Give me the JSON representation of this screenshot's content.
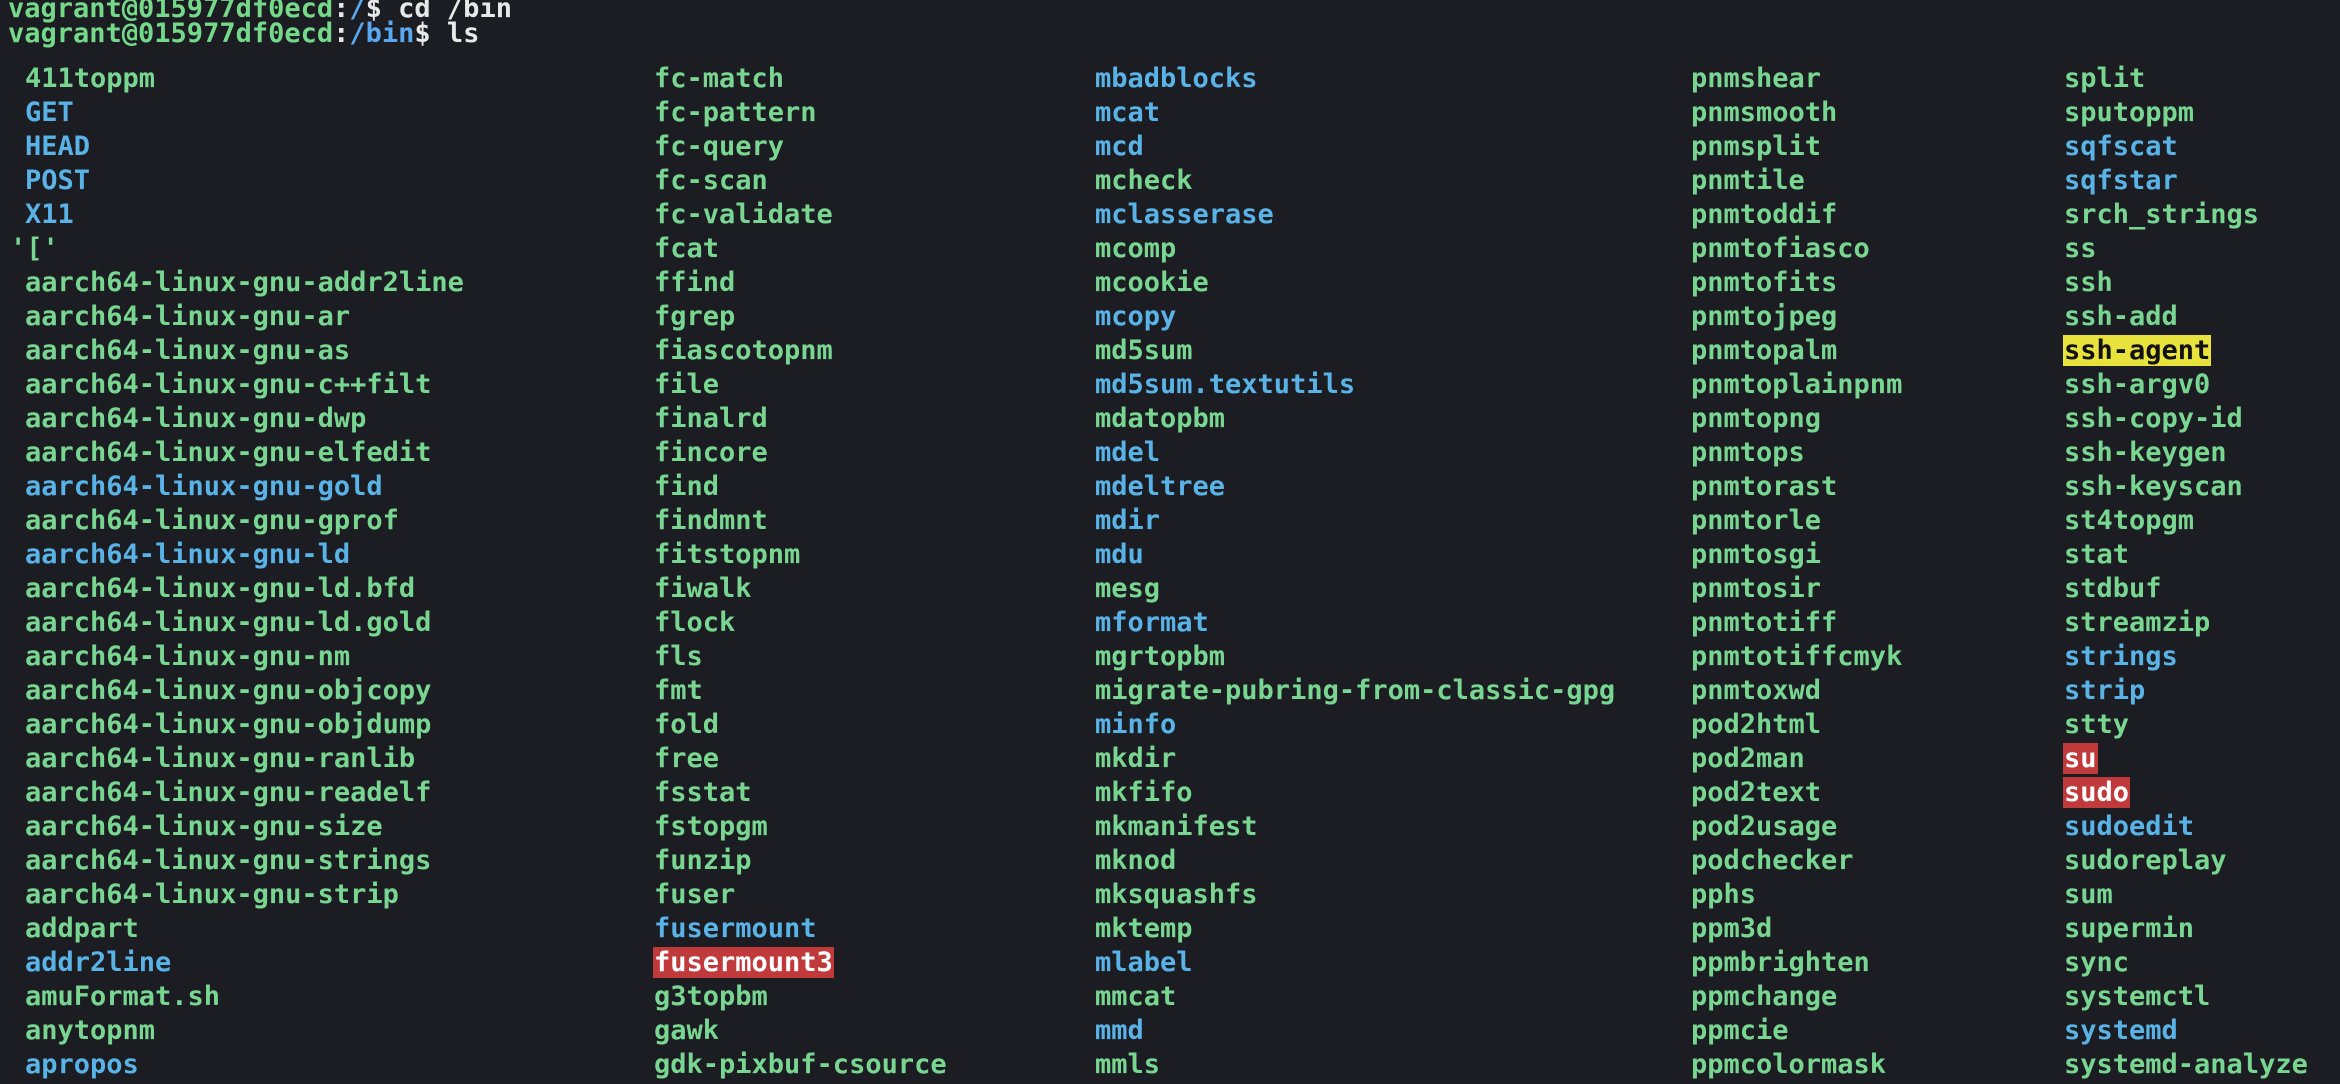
{
  "prompt1": {
    "user_host": "vagrant@015977df0ecd",
    "sep": ":",
    "path": "/",
    "dollar": "$",
    "command": " cd /bin"
  },
  "prompt2": {
    "user_host": "vagrant@015977df0ecd",
    "sep": ":",
    "path": "/bin",
    "dollar": "$",
    "command": " ls"
  },
  "colors": {
    "background": "#1b1d23",
    "executable": "#79d691",
    "symlink": "#5ab3e6",
    "setuid_bg": "#c0393b",
    "setgid_bg": "#e7e33c"
  },
  "listing": {
    "columns": [
      [
        {
          "name": "411toppm",
          "type": "exec"
        },
        {
          "name": "GET",
          "type": "link"
        },
        {
          "name": "HEAD",
          "type": "link"
        },
        {
          "name": "POST",
          "type": "link"
        },
        {
          "name": "X11",
          "type": "link"
        },
        {
          "name": "'['",
          "type": "exec"
        },
        {
          "name": "aarch64-linux-gnu-addr2line",
          "type": "exec"
        },
        {
          "name": "aarch64-linux-gnu-ar",
          "type": "exec"
        },
        {
          "name": "aarch64-linux-gnu-as",
          "type": "exec"
        },
        {
          "name": "aarch64-linux-gnu-c++filt",
          "type": "exec"
        },
        {
          "name": "aarch64-linux-gnu-dwp",
          "type": "exec"
        },
        {
          "name": "aarch64-linux-gnu-elfedit",
          "type": "exec"
        },
        {
          "name": "aarch64-linux-gnu-gold",
          "type": "link"
        },
        {
          "name": "aarch64-linux-gnu-gprof",
          "type": "exec"
        },
        {
          "name": "aarch64-linux-gnu-ld",
          "type": "link"
        },
        {
          "name": "aarch64-linux-gnu-ld.bfd",
          "type": "exec"
        },
        {
          "name": "aarch64-linux-gnu-ld.gold",
          "type": "exec"
        },
        {
          "name": "aarch64-linux-gnu-nm",
          "type": "exec"
        },
        {
          "name": "aarch64-linux-gnu-objcopy",
          "type": "exec"
        },
        {
          "name": "aarch64-linux-gnu-objdump",
          "type": "exec"
        },
        {
          "name": "aarch64-linux-gnu-ranlib",
          "type": "exec"
        },
        {
          "name": "aarch64-linux-gnu-readelf",
          "type": "exec"
        },
        {
          "name": "aarch64-linux-gnu-size",
          "type": "exec"
        },
        {
          "name": "aarch64-linux-gnu-strings",
          "type": "exec"
        },
        {
          "name": "aarch64-linux-gnu-strip",
          "type": "exec"
        },
        {
          "name": "addpart",
          "type": "exec"
        },
        {
          "name": "addr2line",
          "type": "link"
        },
        {
          "name": "amuFormat.sh",
          "type": "exec"
        },
        {
          "name": "anytopnm",
          "type": "exec"
        },
        {
          "name": "apropos",
          "type": "link"
        }
      ],
      [
        {
          "name": "fc-match",
          "type": "exec"
        },
        {
          "name": "fc-pattern",
          "type": "exec"
        },
        {
          "name": "fc-query",
          "type": "exec"
        },
        {
          "name": "fc-scan",
          "type": "exec"
        },
        {
          "name": "fc-validate",
          "type": "exec"
        },
        {
          "name": "fcat",
          "type": "exec"
        },
        {
          "name": "ffind",
          "type": "exec"
        },
        {
          "name": "fgrep",
          "type": "exec"
        },
        {
          "name": "fiascotopnm",
          "type": "exec"
        },
        {
          "name": "file",
          "type": "exec"
        },
        {
          "name": "finalrd",
          "type": "exec"
        },
        {
          "name": "fincore",
          "type": "exec"
        },
        {
          "name": "find",
          "type": "exec"
        },
        {
          "name": "findmnt",
          "type": "exec"
        },
        {
          "name": "fitstopnm",
          "type": "exec"
        },
        {
          "name": "fiwalk",
          "type": "exec"
        },
        {
          "name": "flock",
          "type": "exec"
        },
        {
          "name": "fls",
          "type": "exec"
        },
        {
          "name": "fmt",
          "type": "exec"
        },
        {
          "name": "fold",
          "type": "exec"
        },
        {
          "name": "free",
          "type": "exec"
        },
        {
          "name": "fsstat",
          "type": "exec"
        },
        {
          "name": "fstopgm",
          "type": "exec"
        },
        {
          "name": "funzip",
          "type": "exec"
        },
        {
          "name": "fuser",
          "type": "exec"
        },
        {
          "name": "fusermount",
          "type": "link"
        },
        {
          "name": "fusermount3",
          "type": "setuid"
        },
        {
          "name": "g3topbm",
          "type": "exec"
        },
        {
          "name": "gawk",
          "type": "exec"
        },
        {
          "name": "gdk-pixbuf-csource",
          "type": "exec"
        }
      ],
      [
        {
          "name": "mbadblocks",
          "type": "link"
        },
        {
          "name": "mcat",
          "type": "link"
        },
        {
          "name": "mcd",
          "type": "link"
        },
        {
          "name": "mcheck",
          "type": "exec"
        },
        {
          "name": "mclasserase",
          "type": "link"
        },
        {
          "name": "mcomp",
          "type": "exec"
        },
        {
          "name": "mcookie",
          "type": "exec"
        },
        {
          "name": "mcopy",
          "type": "link"
        },
        {
          "name": "md5sum",
          "type": "exec"
        },
        {
          "name": "md5sum.textutils",
          "type": "link"
        },
        {
          "name": "mdatopbm",
          "type": "exec"
        },
        {
          "name": "mdel",
          "type": "link"
        },
        {
          "name": "mdeltree",
          "type": "link"
        },
        {
          "name": "mdir",
          "type": "link"
        },
        {
          "name": "mdu",
          "type": "link"
        },
        {
          "name": "mesg",
          "type": "exec"
        },
        {
          "name": "mformat",
          "type": "link"
        },
        {
          "name": "mgrtopbm",
          "type": "exec"
        },
        {
          "name": "migrate-pubring-from-classic-gpg",
          "type": "exec"
        },
        {
          "name": "minfo",
          "type": "link"
        },
        {
          "name": "mkdir",
          "type": "exec"
        },
        {
          "name": "mkfifo",
          "type": "exec"
        },
        {
          "name": "mkmanifest",
          "type": "exec"
        },
        {
          "name": "mknod",
          "type": "exec"
        },
        {
          "name": "mksquashfs",
          "type": "exec"
        },
        {
          "name": "mktemp",
          "type": "exec"
        },
        {
          "name": "mlabel",
          "type": "link"
        },
        {
          "name": "mmcat",
          "type": "exec"
        },
        {
          "name": "mmd",
          "type": "link"
        },
        {
          "name": "mmls",
          "type": "exec"
        }
      ],
      [
        {
          "name": "pnmshear",
          "type": "exec"
        },
        {
          "name": "pnmsmooth",
          "type": "exec"
        },
        {
          "name": "pnmsplit",
          "type": "exec"
        },
        {
          "name": "pnmtile",
          "type": "exec"
        },
        {
          "name": "pnmtoddif",
          "type": "exec"
        },
        {
          "name": "pnmtofiasco",
          "type": "exec"
        },
        {
          "name": "pnmtofits",
          "type": "exec"
        },
        {
          "name": "pnmtojpeg",
          "type": "exec"
        },
        {
          "name": "pnmtopalm",
          "type": "exec"
        },
        {
          "name": "pnmtoplainpnm",
          "type": "exec"
        },
        {
          "name": "pnmtopng",
          "type": "exec"
        },
        {
          "name": "pnmtops",
          "type": "exec"
        },
        {
          "name": "pnmtorast",
          "type": "exec"
        },
        {
          "name": "pnmtorle",
          "type": "exec"
        },
        {
          "name": "pnmtosgi",
          "type": "exec"
        },
        {
          "name": "pnmtosir",
          "type": "exec"
        },
        {
          "name": "pnmtotiff",
          "type": "exec"
        },
        {
          "name": "pnmtotiffcmyk",
          "type": "exec"
        },
        {
          "name": "pnmtoxwd",
          "type": "exec"
        },
        {
          "name": "pod2html",
          "type": "exec"
        },
        {
          "name": "pod2man",
          "type": "exec"
        },
        {
          "name": "pod2text",
          "type": "exec"
        },
        {
          "name": "pod2usage",
          "type": "exec"
        },
        {
          "name": "podchecker",
          "type": "exec"
        },
        {
          "name": "pphs",
          "type": "exec"
        },
        {
          "name": "ppm3d",
          "type": "exec"
        },
        {
          "name": "ppmbrighten",
          "type": "exec"
        },
        {
          "name": "ppmchange",
          "type": "exec"
        },
        {
          "name": "ppmcie",
          "type": "exec"
        },
        {
          "name": "ppmcolormask",
          "type": "exec"
        }
      ],
      [
        {
          "name": "split",
          "type": "exec"
        },
        {
          "name": "sputoppm",
          "type": "exec"
        },
        {
          "name": "sqfscat",
          "type": "link"
        },
        {
          "name": "sqfstar",
          "type": "link"
        },
        {
          "name": "srch_strings",
          "type": "exec"
        },
        {
          "name": "ss",
          "type": "exec"
        },
        {
          "name": "ssh",
          "type": "exec"
        },
        {
          "name": "ssh-add",
          "type": "exec"
        },
        {
          "name": "ssh-agent",
          "type": "setgid"
        },
        {
          "name": "ssh-argv0",
          "type": "exec"
        },
        {
          "name": "ssh-copy-id",
          "type": "exec"
        },
        {
          "name": "ssh-keygen",
          "type": "exec"
        },
        {
          "name": "ssh-keyscan",
          "type": "exec"
        },
        {
          "name": "st4topgm",
          "type": "exec"
        },
        {
          "name": "stat",
          "type": "exec"
        },
        {
          "name": "stdbuf",
          "type": "exec"
        },
        {
          "name": "streamzip",
          "type": "exec"
        },
        {
          "name": "strings",
          "type": "link"
        },
        {
          "name": "strip",
          "type": "link"
        },
        {
          "name": "stty",
          "type": "exec"
        },
        {
          "name": "su",
          "type": "setuid"
        },
        {
          "name": "sudo",
          "type": "setuid"
        },
        {
          "name": "sudoedit",
          "type": "link"
        },
        {
          "name": "sudoreplay",
          "type": "exec"
        },
        {
          "name": "sum",
          "type": "exec"
        },
        {
          "name": "supermin",
          "type": "exec"
        },
        {
          "name": "sync",
          "type": "exec"
        },
        {
          "name": "systemctl",
          "type": "exec"
        },
        {
          "name": "systemd",
          "type": "link"
        },
        {
          "name": "systemd-analyze",
          "type": "exec"
        }
      ]
    ]
  }
}
